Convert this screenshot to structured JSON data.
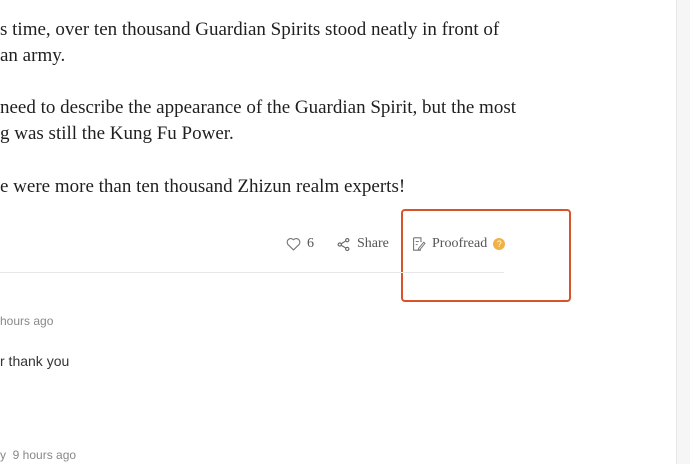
{
  "chapter": {
    "paragraphs": [
      [
        "s time, over ten thousand Guardian Spirits stood neatly in front of",
        " an army."
      ],
      [
        "need to describe the appearance of the Guardian Spirit, but the most",
        "g was still the Kung Fu Power."
      ],
      [
        "e were more than ten thousand Zhizun realm experts!"
      ]
    ]
  },
  "actions": {
    "like_count": "6",
    "share_label": "Share",
    "proofread_label": "Proofread",
    "help_badge": "?"
  },
  "comments": [
    {
      "meta": "hours ago",
      "text": "r thank you"
    },
    {
      "meta": "y  9 hours ago"
    }
  ],
  "colors": {
    "highlight": "#d9532a",
    "badge": "#f0b247"
  }
}
